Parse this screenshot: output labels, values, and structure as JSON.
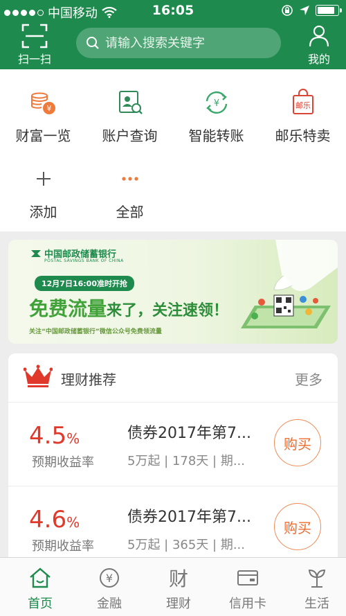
{
  "status_bar": {
    "carrier": "中国移动",
    "time": "16:05"
  },
  "header": {
    "scan_label": "扫一扫",
    "search_placeholder": "请输入搜索关键字",
    "me_label": "我的"
  },
  "menu": [
    {
      "label": "财富一览",
      "icon": "coins-icon"
    },
    {
      "label": "账户查询",
      "icon": "account-search-icon"
    },
    {
      "label": "智能转账",
      "icon": "transfer-icon"
    },
    {
      "label": "邮乐特卖",
      "icon": "shopping-bag-icon",
      "icon_text": "邮乐"
    },
    {
      "label": "添加",
      "icon": "plus-icon"
    },
    {
      "label": "全部",
      "icon": "more-dots-icon"
    }
  ],
  "banner": {
    "logo_text": "中国邮政储蓄银行",
    "logo_sub": "POSTAL SAVINGS BANK OF CHINA",
    "date_tag": "12月7日16:00准时开抢",
    "headline_big": "免费流量",
    "headline_small": "来了，关注速领！",
    "note": "关注“中国邮政储蓄银行”微信公众号免费领流量"
  },
  "recommend": {
    "title": "理财推荐",
    "more": "更多",
    "products": [
      {
        "rate": "4.5",
        "unit": "%",
        "rate_label": "预期收益率",
        "name": "债券2017年第7...",
        "meta": "5万起 | 178天 | 期...",
        "buy": "购买"
      },
      {
        "rate": "4.6",
        "unit": "%",
        "rate_label": "预期收益率",
        "name": "债券2017年第7...",
        "meta": "5万起 | 365天 | 期...",
        "buy": "购买"
      }
    ]
  },
  "tabs": [
    {
      "label": "首页",
      "icon": "home-icon",
      "active": true
    },
    {
      "label": "金融",
      "icon": "finance-icon",
      "active": false
    },
    {
      "label": "理财",
      "icon": "wealth-icon",
      "active": false
    },
    {
      "label": "信用卡",
      "icon": "credit-card-icon",
      "active": false
    },
    {
      "label": "生活",
      "icon": "life-plant-icon",
      "active": false
    }
  ],
  "colors": {
    "brand_green": "#1f8a4d",
    "accent_red": "#e0392b",
    "buy_orange": "#ee6b2e"
  }
}
